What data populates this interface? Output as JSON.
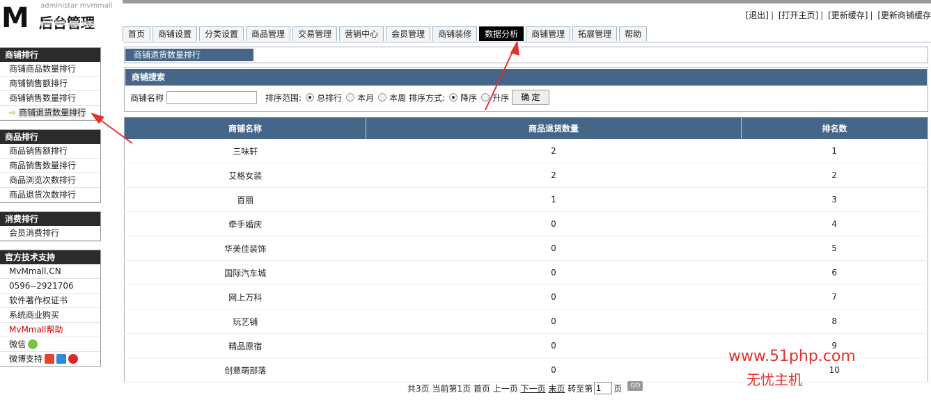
{
  "header": {
    "logo_letter": "M",
    "admin_text": "administar mvmmall",
    "title": "后台管理",
    "links": [
      "[退出]",
      "[打开主页]",
      "[更新缓存]",
      "[更新商铺缓存"
    ]
  },
  "nav": {
    "tabs": [
      "首页",
      "商铺设置",
      "分类设置",
      "商品管理",
      "交易管理",
      "营销中心",
      "会员管理",
      "商铺装修",
      "数据分析",
      "商铺管理",
      "拓展管理",
      "帮助"
    ],
    "active_index": 8
  },
  "sidebar": {
    "groups": [
      {
        "title": "商铺排行",
        "items": [
          "商铺商品数量排行",
          "商铺销售额排行",
          "商铺销售数量排行",
          "商铺退货数量排行"
        ]
      },
      {
        "title": "商品排行",
        "items": [
          "商品销售额排行",
          "商品销售数量排行",
          "商品浏览次数排行",
          "商品退货次数排行"
        ]
      },
      {
        "title": "消费排行",
        "items": [
          "会员消费排行"
        ]
      },
      {
        "title": "官方技术支持",
        "items": [
          "MvMmall.CN",
          "0596--2921706",
          "软件著作权证书",
          "系统商业购买",
          "MvMmall帮助",
          "微信",
          "微博支持"
        ]
      }
    ]
  },
  "breadcrumb": "商铺退货数量排行",
  "search": {
    "title": "商铺搜索",
    "name_label": "商铺名称",
    "name_value": "",
    "range_label": "排序范围:",
    "range_options": [
      "总排行",
      "本月",
      "本周"
    ],
    "order_label": "排序方式:",
    "order_options": [
      "降序",
      "升序"
    ],
    "submit": "确 定"
  },
  "table": {
    "columns": [
      "商铺名称",
      "商品退货数量",
      "排名数"
    ],
    "rows": [
      [
        "三味轩",
        "2",
        "1"
      ],
      [
        "艾格女装",
        "2",
        "2"
      ],
      [
        "百丽",
        "1",
        "3"
      ],
      [
        "牵手婚庆",
        "0",
        "4"
      ],
      [
        "华美佳装饰",
        "0",
        "5"
      ],
      [
        "国际汽车城",
        "0",
        "6"
      ],
      [
        "网上万科",
        "0",
        "7"
      ],
      [
        "玩艺铺",
        "0",
        "8"
      ],
      [
        "精品原宿",
        "0",
        "9"
      ],
      [
        "创意萌部落",
        "0",
        "10"
      ]
    ]
  },
  "pager": {
    "summary": "共3页 当前第1页 首页 上一页",
    "next": "下一页",
    "last": "末页",
    "goto_label": "转至第",
    "page_value": "1",
    "page_unit": "页",
    "go": "GO"
  },
  "watermark": {
    "url": "www.51php.com",
    "name": "无忧主机"
  },
  "colors": {
    "header_blue": "#456688",
    "dark": "#2b2b2b",
    "annotation_red": "#e4312b"
  }
}
